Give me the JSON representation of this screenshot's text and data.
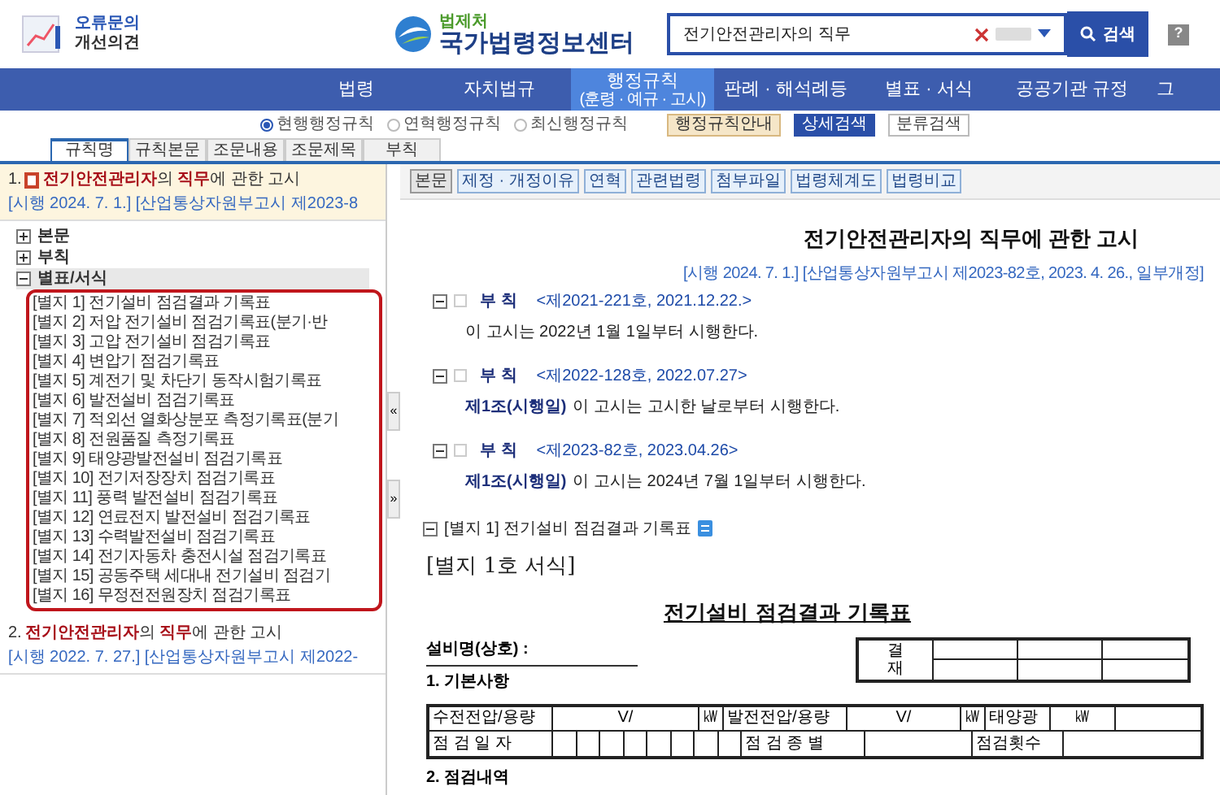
{
  "header": {
    "feedback_lines": [
      "오류문의",
      "개선의견"
    ],
    "brand_small": "법제처",
    "brand": "국가법령정보센터",
    "search_value": "전기안전관리자의 직무",
    "search_button": "검색",
    "help": "?"
  },
  "nav": [
    {
      "label": "법령",
      "selected": false
    },
    {
      "label": "자치법규",
      "selected": false
    },
    {
      "label": "행정규칙",
      "sub": "(훈령 · 예규 · 고시)",
      "selected": true
    },
    {
      "label": "판례 · 해석례등",
      "selected": false
    },
    {
      "label": "별표 · 서식",
      "selected": false
    },
    {
      "label": "공공기관 규정",
      "selected": false
    },
    {
      "label": "그",
      "selected": false
    }
  ],
  "radios": [
    {
      "label": "현행행정규칙",
      "selected": true
    },
    {
      "label": "연혁행정규칙",
      "selected": false
    },
    {
      "label": "최신행정규칙",
      "selected": false
    }
  ],
  "option_buttons": [
    {
      "label": "행정규칙안내",
      "kind": "guide"
    },
    {
      "label": "상세검색",
      "kind": "detail"
    },
    {
      "label": "분류검색",
      "kind": "category"
    }
  ],
  "subtabs": [
    {
      "label": "규칙명",
      "selected": true
    },
    {
      "label": "규칙본문",
      "selected": false
    },
    {
      "label": "조문내용",
      "selected": false
    },
    {
      "label": "조문제목",
      "selected": false
    },
    {
      "label": "부칙",
      "selected": false
    }
  ],
  "results": [
    {
      "number": "1.",
      "selected": true,
      "title_parts": [
        {
          "text": "전기안전관리자",
          "highlight": true
        },
        {
          "text": "의 ",
          "highlight": false
        },
        {
          "text": "직무",
          "highlight": true
        },
        {
          "text": "에 관한 고시",
          "highlight": false
        }
      ],
      "meta": "[시행 2024. 7. 1.] [산업통상자원부고시 제2023-8",
      "tree": [
        {
          "label": "본문",
          "expanded": false,
          "selected": false
        },
        {
          "label": "부칙",
          "expanded": false,
          "selected": false
        },
        {
          "label": "별표/서식",
          "expanded": true,
          "selected": true,
          "children": [
            "[별지 1] 전기설비 점검결과 기록표",
            "[별지 2] 저압 전기설비 점검기록표(분기·반",
            "[별지 3] 고압 전기설비 점검기록표",
            "[별지 4] 변압기 점검기록표",
            "[별지 5] 계전기 및 차단기 동작시험기록표",
            "[별지 6] 발전설비 점검기록표",
            "[별지 7] 적외선 열화상분포 측정기록표(분기",
            "[별지 8] 전원품질 측정기록표",
            "[별지 9] 태양광발전설비 점검기록표",
            "[별지 10] 전기저장장치 점검기록표",
            "[별지 11] 풍력 발전설비 점검기록표",
            "[별지 12] 연료전지 발전설비 점검기록표",
            "[별지 13] 수력발전설비 점검기록표",
            "[별지 14] 전기자동차 충전시설 점검기록표",
            "[별지 15] 공동주택 세대내 전기설비 점검기",
            "[별지 16] 무정전전원장치 점검기록표"
          ]
        }
      ]
    },
    {
      "number": "2.",
      "selected": false,
      "title_parts": [
        {
          "text": "전기안전관리자",
          "highlight": true
        },
        {
          "text": "의 ",
          "highlight": false
        },
        {
          "text": "직무",
          "highlight": true
        },
        {
          "text": "에 관한 고시",
          "highlight": false
        }
      ],
      "meta": "[시행 2022. 7. 27.] [산업통상자원부고시 제2022-"
    }
  ],
  "toolbar": [
    {
      "label": "본문",
      "selected": true
    },
    {
      "label": "제정 · 개정이유",
      "selected": false
    },
    {
      "label": "연혁",
      "selected": false
    },
    {
      "label": "관련법령",
      "selected": false
    },
    {
      "label": "첨부파일",
      "selected": false
    },
    {
      "label": "법령체계도",
      "selected": false
    },
    {
      "label": "법령비교",
      "selected": false
    }
  ],
  "doc_title": "전기안전관리자의 직무에 관한 고시",
  "doc_meta": "[시행 2024. 7. 1.] [산업통상자원부고시 제2023-82호, 2023. 4. 26., 일부개정]",
  "side_handles": [
    "«",
    "»"
  ],
  "addenda": [
    {
      "heading": "부 칙",
      "ref": "<제2021-221호, 2021.12.22.>",
      "checked": false,
      "text": "이 고시는 2022년 1월 1일부터 시행한다."
    },
    {
      "heading": "부 칙",
      "ref": "<제2022-128호, 2022.07.27>",
      "checked": false,
      "article": "제1조(시행일)",
      "text": "이 고시는 고시한 날로부터 시행한다."
    },
    {
      "heading": "부 칙",
      "ref": "<제2023-82호, 2023.04.26>",
      "checked": false,
      "article": "제1조(시행일)",
      "text": "이 고시는 2024년 7월 1일부터 시행한다."
    }
  ],
  "attachment": {
    "label": "[별지 1] 전기설비 점검결과 기록표"
  },
  "form": {
    "number": "[별지 1호 서식]",
    "title": "전기설비 점검결과 기록표",
    "facility": "설비명(상호) :",
    "section1": "1. 기본사항",
    "approval": "결재",
    "row1": [
      "수전전압/용량",
      "V/",
      "㎾",
      "발전전압/용량",
      "V/",
      "㎾",
      "태양광",
      "㎾"
    ],
    "row2": [
      "점 검 일 자",
      "점 검 종 별",
      "점검횟수"
    ],
    "section2": "2. 점검내역"
  }
}
